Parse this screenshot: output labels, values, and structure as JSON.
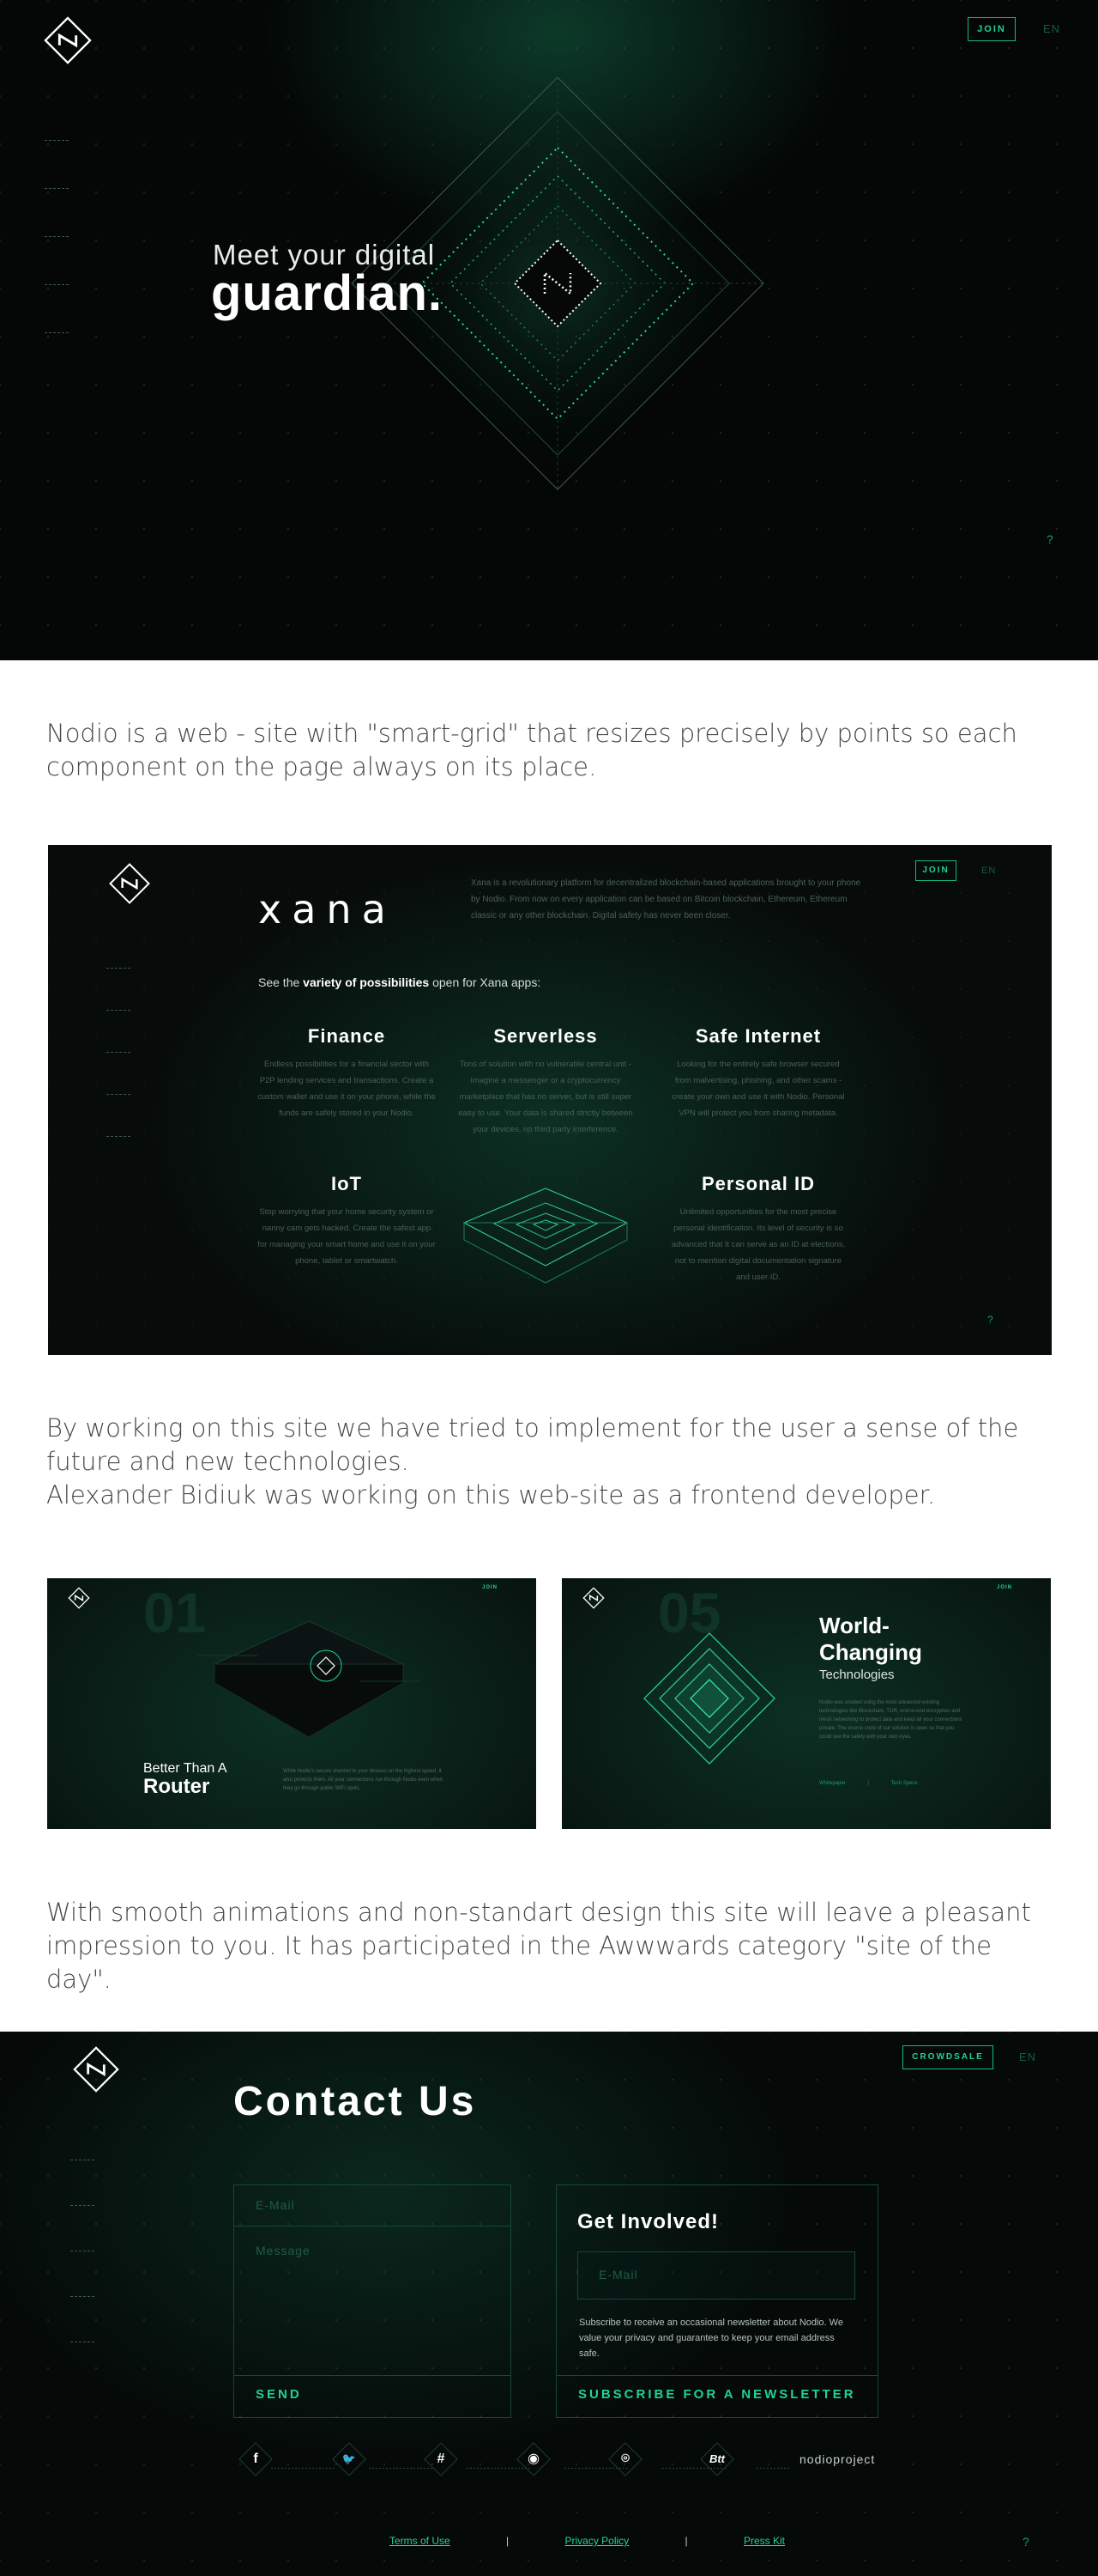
{
  "hero": {
    "join_label": "JOIN",
    "lang_label": "EN",
    "help_label": "?",
    "meet": "Meet your digital",
    "guardian": "guardian."
  },
  "descriptions": {
    "intro": "Nodio is a web - site with \"smart-grid\" that resizes precisely by points so each component on the page always on its place.",
    "future_1": "By working on this site we have tried to implement for the user a sense of the future and new technologies.",
    "future_2": "Alexander Bidiuk was working on this web-site as a frontend developer.",
    "awwwards": "With smooth animations and non-standart design this site will leave a pleasant impression to you. It has participated in the Awwwards category \"site of the day\"."
  },
  "xana": {
    "join_label": "JOIN",
    "lang_label": "EN",
    "help_label": "?",
    "title": "xana",
    "intro": "Xana is a revolutionary platform for decentralized blockchain-based applications brought to your phone by Nodio. From now on every application can be based on Bitcoin blockchain, Ethereum, Ethereum classic or any other blockchain. Digital safety has never been closer.",
    "see_prefix": "See the ",
    "see_bold": "variety of possibilities",
    "see_suffix": " open for Xana apps:",
    "features": [
      {
        "title": "Finance",
        "text": "Endless possibilities for a financial sector with P2P lending services and transactions. Create a custom wallet and use it on your phone, while the funds are safely stored in your Nodio."
      },
      {
        "title": "Serverless",
        "text": "Tons of solution with no vulnerable central unit - imagine a messenger or a cryptocurrency marketplace that has no server, but is still super easy to use. Your data is shared strictly between your devices, no third party interference."
      },
      {
        "title": "Safe Internet",
        "text": "Looking for the entirely safe browser secured from malvertising, phishing, and other scams - create your own and use it with Nodio. Personal VPN will protect you from sharing metadata."
      },
      {
        "title": "IoT",
        "text": "Stop worrying that your home security system or nanny cam gets hacked. Create the safest app for managing your smart home and use it on your phone, tablet or smartwatch."
      },
      {
        "title": "Personal ID",
        "text": "Unlimited opportunities for the most precise personal identification. Its level of security is so advanced that it can serve as an ID at elections, not to mention digital documentation signature and user ID."
      }
    ]
  },
  "shot_router": {
    "number": "01",
    "join_label": "JOIN",
    "title_small": "Better Than A",
    "title_big": "Router",
    "text": "While Nodio's secure channel to your devices on the highest speed, it also protects them. All your connections run through Nodio even when they go through public WiFi spots."
  },
  "shot_world": {
    "number": "05",
    "join_label": "JOIN",
    "title": "World-\nChanging",
    "subtitle": "Technologies",
    "text": "Nodio was created using the most advanced existing technologies like Blockchain, TOR, end-to-end encryption and mesh networking to protect data and keep all your connections private. The source code of our solution is open so that you could see the safety with your own eyes.",
    "link_1": "Whitepaper",
    "link_2": "Tech Specs"
  },
  "contact": {
    "crowdsale_label": "CROWDSALE",
    "lang_label": "EN",
    "help_label": "?",
    "title": "Contact Us",
    "email_placeholder": "E-Mail",
    "message_placeholder": "Message",
    "send_label": "SEND",
    "get_involved": "Get Involved!",
    "newsletter_placeholder": "E-Mail",
    "newsletter_note": "Subscribe to receive an occasional newsletter about Nodio. We value your privacy and guarantee to keep your email address safe.",
    "subscribe_label": "SUBSCRIBE FOR A NEWSLETTER",
    "social": [
      {
        "name": "facebook-icon",
        "glyph": "f"
      },
      {
        "name": "twitter-icon",
        "glyph": "🐦"
      },
      {
        "name": "slack-icon",
        "glyph": "#"
      },
      {
        "name": "reddit-icon",
        "glyph": "◉"
      },
      {
        "name": "github-icon",
        "glyph": "⌾"
      },
      {
        "name": "bitcointalk-icon",
        "glyph": "Btt"
      }
    ],
    "handle": "nodioproject",
    "footer": {
      "terms": "Terms of Use",
      "privacy": "Privacy Policy",
      "press": "Press Kit",
      "separator": "|"
    }
  },
  "colors": {
    "accent": "#1fd394",
    "dark_bg": "#040706",
    "muted_text": "#444a48"
  }
}
